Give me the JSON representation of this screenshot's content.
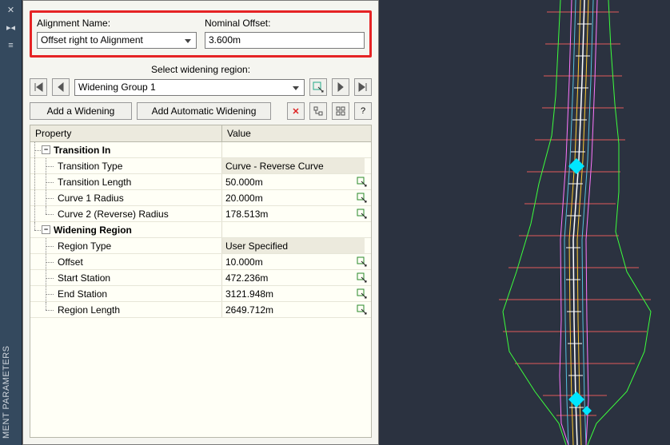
{
  "header": {
    "alignment_label": "Alignment Name:",
    "alignment_value": "Offset right to Alignment",
    "nominal_label": "Nominal Offset:",
    "nominal_value": "3.600m"
  },
  "widening_selector": {
    "label": "Select widening region:",
    "value": "Widening Group 1"
  },
  "buttons": {
    "add_widening": "Add a Widening",
    "add_auto_widening": "Add Automatic Widening"
  },
  "grid": {
    "col_property": "Property",
    "col_value": "Value",
    "groups": [
      {
        "name": "Transition In",
        "rows": [
          {
            "label": "Transition Type",
            "value": "Curve - Reverse Curve",
            "picker": false,
            "ro": true
          },
          {
            "label": "Transition Length",
            "value": "50.000m",
            "picker": true
          },
          {
            "label": "Curve 1 Radius",
            "value": "20.000m",
            "picker": true
          },
          {
            "label": "Curve 2 (Reverse) Radius",
            "value": "178.513m",
            "picker": true
          }
        ]
      },
      {
        "name": "Widening Region",
        "rows": [
          {
            "label": "Region Type",
            "value": "User Specified",
            "picker": false,
            "ro": true
          },
          {
            "label": "Offset",
            "value": "10.000m",
            "picker": true
          },
          {
            "label": "Start Station",
            "value": "472.236m",
            "picker": true
          },
          {
            "label": "End Station",
            "value": "3121.948m",
            "picker": true
          },
          {
            "label": "Region Length",
            "value": "2649.712m",
            "picker": true
          }
        ]
      }
    ]
  },
  "palette_title": "MENT PARAMETERS"
}
